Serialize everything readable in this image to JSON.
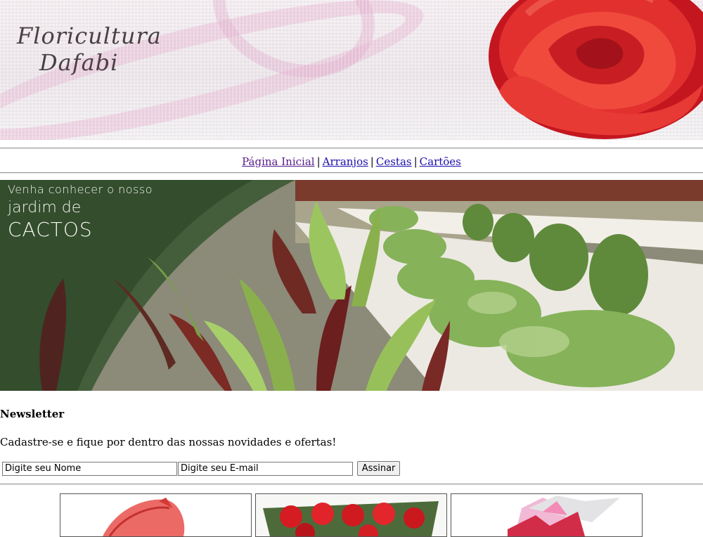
{
  "header": {
    "logo_line1": "Floricultura",
    "logo_line2": "Dafabi"
  },
  "nav": {
    "items": [
      {
        "label": "Página Inicial",
        "visited": true
      },
      {
        "label": "Arranjos"
      },
      {
        "label": "Cestas"
      },
      {
        "label": "Cartões"
      }
    ],
    "separator": "|"
  },
  "promo_banner": {
    "line1": "Venha conhecer o nosso",
    "line2": "jardim de",
    "line3": "CACTOS"
  },
  "newsletter": {
    "title": "Newsletter",
    "description": "Cadastre-se e fique por dentro das nossas novidades e ofertas!",
    "name_value": "Digite seu Nome",
    "email_value": "Digite seu E-mail",
    "submit_label": "Assinar"
  },
  "colors": {
    "link": "#1a0dab",
    "link_visited": "#551a8b",
    "rose": "#d8262b"
  }
}
